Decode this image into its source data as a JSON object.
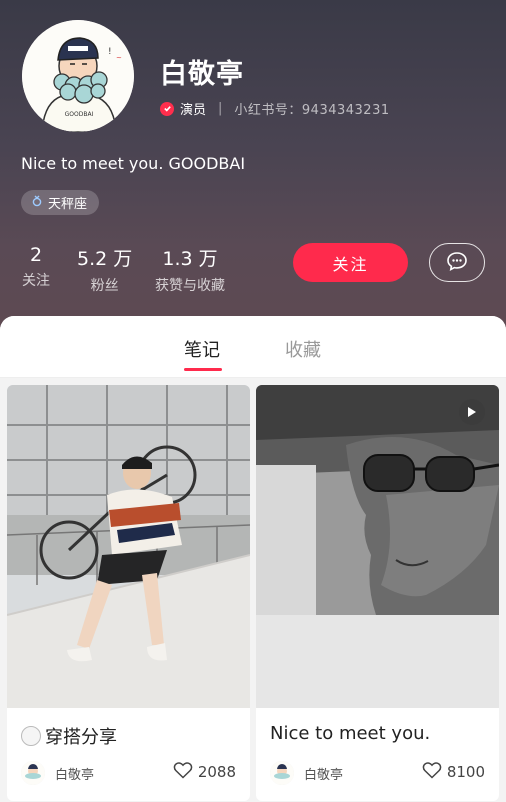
{
  "profile": {
    "name": "白敬亭",
    "role": "演员",
    "separator": "|",
    "red_id": "小红书号：9434343231",
    "bio": "Nice to meet you. GOODBAI",
    "tag": "天秤座",
    "avatar_text": "GOODBAI",
    "stats": [
      {
        "value": "2",
        "label": "关注"
      },
      {
        "value": "5.2 万",
        "label": "粉丝"
      },
      {
        "value": "1.3 万",
        "label": "获赞与收藏"
      }
    ],
    "follow_label": "关注",
    "icons": {
      "verify": "verified-check-icon",
      "tag": "libra-icon",
      "message": "chat-bubble-icon"
    }
  },
  "tabs": {
    "notes": "笔记",
    "favorites": "收藏"
  },
  "notes": [
    {
      "title": "穿搭分享",
      "author": "白敬亭",
      "likes": "2088",
      "type": "image"
    },
    {
      "title": "Nice to meet you.",
      "author": "白敬亭",
      "likes": "8100",
      "type": "video"
    }
  ],
  "colors": {
    "accent": "#ff2a4c",
    "header_top": "#3a3a47",
    "header_bottom": "#5e4a52"
  }
}
